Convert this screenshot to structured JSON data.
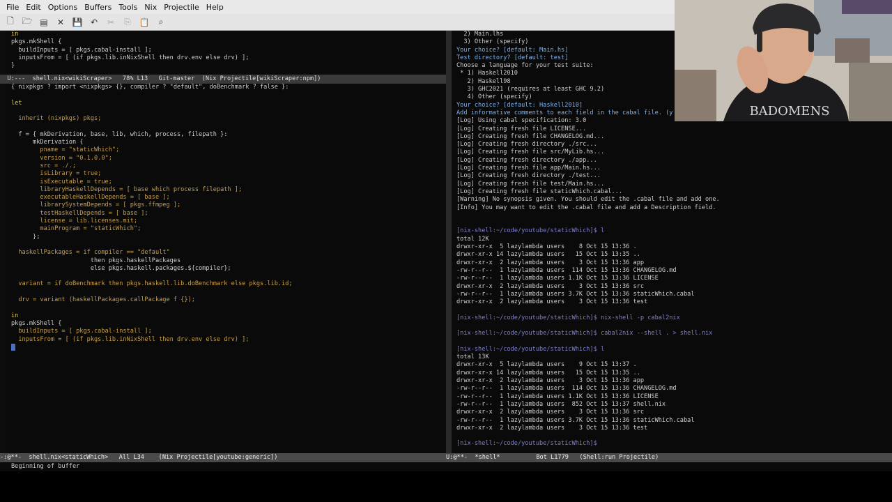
{
  "menubar": {
    "items": [
      "File",
      "Edit",
      "Options",
      "Buffers",
      "Tools",
      "Nix",
      "Projectile",
      "Help"
    ]
  },
  "toolbar": {
    "icons": [
      "new-file-icon",
      "open-folder-icon",
      "open-dir-icon",
      "close-icon",
      "save-icon",
      "undo-icon",
      "cut-icon",
      "copy-icon",
      "paste-icon",
      "search-icon"
    ]
  },
  "top_buffer": {
    "lines": [
      "in",
      "pkgs.mkShell {",
      "  buildInputs = [ pkgs.cabal-install ];",
      "  inputsFrom = [ (if pkgs.lib.inNixShell then drv.env else drv) ];",
      "}"
    ],
    "modeline": "  U:---  shell.nix<wikiScraper>   78% L13   Git-master  (Nix Projectile[wikiScraper:npm])"
  },
  "main_buffer": {
    "lines": [
      "{ nixpkgs ? import <nixpkgs> {}, compiler ? \"default\", doBenchmark ? false }:",
      "",
      "let",
      "",
      "  inherit (nixpkgs) pkgs;",
      "",
      "  f = { mkDerivation, base, lib, which, process, filepath }:",
      "      mkDerivation {",
      "        pname = \"staticWhich\";",
      "        version = \"0.1.0.0\";",
      "        src = ./.;",
      "        isLibrary = true;",
      "        isExecutable = true;",
      "        libraryHaskellDepends = [ base which process filepath ];",
      "        executableHaskellDepends = [ base ];",
      "        librarySystemDepends = [ pkgs.ffmpeg ];",
      "        testHaskellDepends = [ base ];",
      "        license = lib.licenses.mit;",
      "        mainProgram = \"staticWhich\";",
      "      };",
      "",
      "  haskellPackages = if compiler == \"default\"",
      "                      then pkgs.haskellPackages",
      "                      else pkgs.haskell.packages.${compiler};",
      "",
      "  variant = if doBenchmark then pkgs.haskell.lib.doBenchmark else pkgs.lib.id;",
      "",
      "  drv = variant (haskellPackages.callPackage f {});",
      "",
      "in",
      "pkgs.mkShell {",
      "  buildInputs = [ pkgs.cabal-install ];",
      "  inputsFrom = [ (if pkgs.lib.inNixShell then drv.env else drv) ];",
      "}"
    ],
    "modeline": "-:@**-  shell.nix<staticWhich>   All L34    (Nix Projectile[youtube:generic])"
  },
  "shell_buffer": {
    "lines": [
      "  2) Main.lhs",
      "  3) Other (specify)",
      "Your choice? [default: Main.hs]",
      "Test directory? [default: test]",
      "Choose a language for your test suite:",
      " * 1) Haskell2010",
      "   2) Haskell98",
      "   3) GHC2021 (requires at least GHC 9.2)",
      "   4) Other (specify)",
      "Your choice? [default: Haskell2010]",
      "Add informative comments to each field in the cabal file. (y",
      "[Log] Using cabal specification: 3.0",
      "[Log] Creating fresh file LICENSE...",
      "[Log] Creating fresh file CHANGELOG.md...",
      "[Log] Creating fresh directory ./src...",
      "[Log] Creating fresh file src/MyLib.hs...",
      "[Log] Creating fresh directory ./app...",
      "[Log] Creating fresh file app/Main.hs...",
      "[Log] Creating fresh directory ./test...",
      "[Log] Creating fresh file test/Main.hs...",
      "[Log] Creating fresh file staticWhich.cabal...",
      "[Warning] No synopsis given. You should edit the .cabal file and add one.",
      "[Info] You may want to edit the .cabal file and add a Description field.",
      "",
      "",
      "[nix-shell:~/code/youtube/staticWhich]$ l",
      "total 12K",
      "drwxr-xr-x  5 lazylambda users    8 Oct 15 13:36 .",
      "drwxr-xr-x 14 lazylambda users   15 Oct 15 13:35 ..",
      "drwxr-xr-x  2 lazylambda users    3 Oct 15 13:36 app",
      "-rw-r--r--  1 lazylambda users  114 Oct 15 13:36 CHANGELOG.md",
      "-rw-r--r--  1 lazylambda users 1.1K Oct 15 13:36 LICENSE",
      "drwxr-xr-x  2 lazylambda users    3 Oct 15 13:36 src",
      "-rw-r--r--  1 lazylambda users 3.7K Oct 15 13:36 staticWhich.cabal",
      "drwxr-xr-x  2 lazylambda users    3 Oct 15 13:36 test",
      "",
      "[nix-shell:~/code/youtube/staticWhich]$ nix-shell -p cabal2nix",
      "",
      "[nix-shell:~/code/youtube/staticWhich]$ cabal2nix --shell . > shell.nix",
      "",
      "[nix-shell:~/code/youtube/staticWhich]$ l",
      "total 13K",
      "drwxr-xr-x  5 lazylambda users    9 Oct 15 13:37 .",
      "drwxr-xr-x 14 lazylambda users   15 Oct 15 13:35 ..",
      "drwxr-xr-x  2 lazylambda users    3 Oct 15 13:36 app",
      "-rw-r--r--  1 lazylambda users  114 Oct 15 13:36 CHANGELOG.md",
      "-rw-r--r--  1 lazylambda users 1.1K Oct 15 13:36 LICENSE",
      "-rw-r--r--  1 lazylambda users  852 Oct 15 13:37 shell.nix",
      "drwxr-xr-x  2 lazylambda users    3 Oct 15 13:36 src",
      "-rw-r--r--  1 lazylambda users 3.7K Oct 15 13:36 staticWhich.cabal",
      "drwxr-xr-x  2 lazylambda users    3 Oct 15 13:36 test",
      "",
      "[nix-shell:~/code/youtube/staticWhich]$ "
    ],
    "modeline": "U:@**-  *shell*          Bot L1779   (Shell:run Projectile)"
  },
  "minibuffer": "Beginning of buffer",
  "webcam": {
    "shirt_text": "BADOMENS"
  }
}
